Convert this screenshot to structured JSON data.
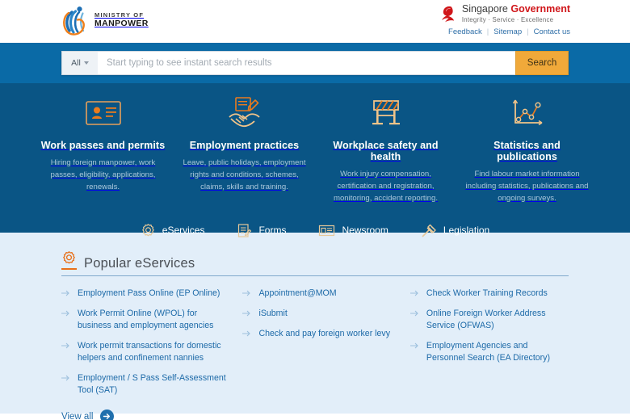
{
  "header": {
    "logo": {
      "icon": "mom-swoosh-logo",
      "line1": "MINISTRY OF",
      "line2": "MANPOWER"
    },
    "government": {
      "icon": "singapore-lion-logo",
      "name_light": "Singapore ",
      "name_bold": "Government",
      "tagline": "Integrity  ·  Service  ·  Excellence",
      "links": [
        {
          "label": "Feedback"
        },
        {
          "label": "Sitemap"
        },
        {
          "label": "Contact us"
        }
      ]
    }
  },
  "search": {
    "scope_label": "All",
    "scope_icon": "chevron-down-icon",
    "placeholder": "Start typing to see instant search results",
    "value": "",
    "button_label": "Search"
  },
  "feature_cards": [
    {
      "icon": "id-card-icon",
      "title": "Work passes and permits",
      "desc": "Hiring foreign manpower, work passes, eligibility, applications, renewals."
    },
    {
      "icon": "handshake-document-icon",
      "title": "Employment practices",
      "desc": "Leave, public holidays, employment rights and conditions, schemes, claims, skills and training."
    },
    {
      "icon": "safety-barrier-icon",
      "title": "Workplace safety and health",
      "desc": "Work injury compensation, certification and registration, monitoring, accident reporting."
    },
    {
      "icon": "line-chart-icon",
      "title": "Statistics and publications",
      "desc": "Find labour market information including statistics, publications and ongoing surveys."
    }
  ],
  "quick_links": [
    {
      "icon": "gear-icon",
      "label": "eServices"
    },
    {
      "icon": "form-pencil-icon",
      "label": "Forms"
    },
    {
      "icon": "news-card-icon",
      "label": "Newsroom"
    },
    {
      "icon": "gavel-icon",
      "label": "Legislation"
    }
  ],
  "eservices": {
    "heading_icon": "gear-icon",
    "heading": "Popular eServices",
    "columns": [
      {
        "items": [
          {
            "label": "Employment Pass Online (EP Online)"
          },
          {
            "label": "Work Permit Online (WPOL) for business and employment agencies"
          },
          {
            "label": "Work permit transactions for domestic helpers and confinement nannies"
          },
          {
            "label": "Employment / S Pass Self-Assessment Tool (SAT)"
          }
        ]
      },
      {
        "items": [
          {
            "label": "Appointment@MOM"
          },
          {
            "label": "iSubmit"
          },
          {
            "label": "Check and pay foreign worker levy"
          }
        ]
      },
      {
        "items": [
          {
            "label": "Check Worker Training Records"
          },
          {
            "label": "Online Foreign Worker Address Service (OFWAS)"
          },
          {
            "label": "Employment Agencies and Personnel Search (EA Directory)"
          }
        ]
      }
    ],
    "view_all": {
      "label": "View all",
      "icon": "arrow-right-circle-icon"
    }
  },
  "colors": {
    "search_band": "#0a6aa6",
    "feature_band": "#0a5585",
    "eservices_band": "#e2eef9",
    "accent_orange": "#e8701a",
    "search_button": "#f0a93a",
    "link_blue": "#1d6aa8",
    "gov_red": "#d0161a"
  }
}
